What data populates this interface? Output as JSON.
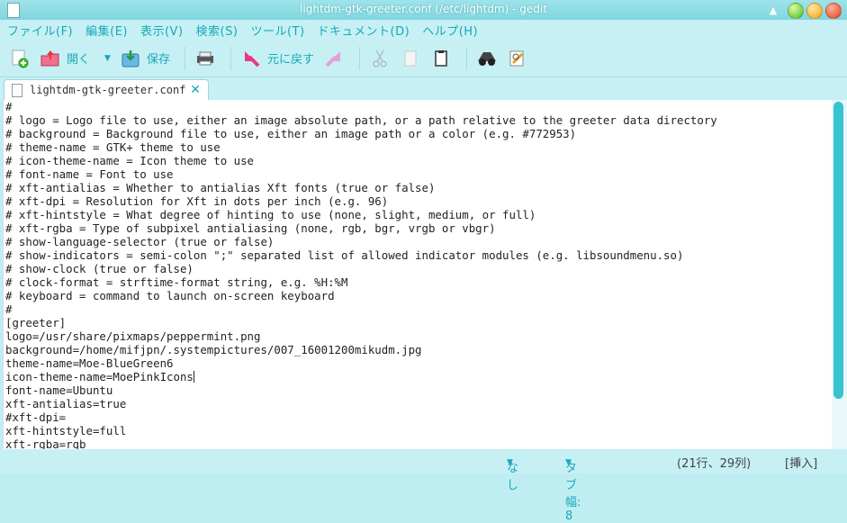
{
  "window": {
    "title": "lightdm-gtk-greeter.conf (/etc/lightdm) - gedit",
    "colors": {
      "accent": "#19a8b8",
      "chrome": "#c6f0f4",
      "titlebar": "#8ad9e1",
      "scroll_thumb": "#37c3cf"
    }
  },
  "menubar": {
    "items": [
      "ファイル(F)",
      "編集(E)",
      "表示(V)",
      "検索(S)",
      "ツール(T)",
      "ドキュメント(D)",
      "ヘルプ(H)"
    ]
  },
  "toolbar": {
    "new_icon": "new-document-icon",
    "open_label": "開く",
    "save_label": "保存",
    "print_icon": "printer-icon",
    "undo_label": "元に戻す",
    "redo_icon": "redo-icon",
    "cut_icon": "scissors-icon",
    "copy_icon": "copy-icon",
    "paste_icon": "paste-icon",
    "find_icon": "binoculars-icon",
    "replace_icon": "find-replace-icon"
  },
  "tab": {
    "label": "lightdm-gtk-greeter.conf"
  },
  "editor": {
    "lines": [
      "#",
      "# logo = Logo file to use, either an image absolute path, or a path relative to the greeter data directory",
      "# background = Background file to use, either an image path or a color (e.g. #772953)",
      "# theme-name = GTK+ theme to use",
      "# icon-theme-name = Icon theme to use",
      "# font-name = Font to use",
      "# xft-antialias = Whether to antialias Xft fonts (true or false)",
      "# xft-dpi = Resolution for Xft in dots per inch (e.g. 96)",
      "# xft-hintstyle = What degree of hinting to use (none, slight, medium, or full)",
      "# xft-rgba = Type of subpixel antialiasing (none, rgb, bgr, vrgb or vbgr)",
      "# show-language-selector (true or false)",
      "# show-indicators = semi-colon \";\" separated list of allowed indicator modules (e.g. libsoundmenu.so)",
      "# show-clock (true or false)",
      "# clock-format = strftime-format string, e.g. %H:%M",
      "# keyboard = command to launch on-screen keyboard",
      "#",
      "[greeter]",
      "logo=/usr/share/pixmaps/peppermint.png",
      "background=/home/mifjpn/.systempictures/007_16001200mikudm.jpg",
      "theme-name=Moe-BlueGreen6",
      "icon-theme-name=MoePinkIcons",
      "font-name=Ubuntu",
      "xft-antialias=true",
      "#xft-dpi=",
      "xft-hintstyle=full",
      "xft-rgba=rgb"
    ],
    "cursor_line": 21,
    "cursor_column": 29
  },
  "statusbar": {
    "language": "なし",
    "tab_width": "タブ幅: 8",
    "position": "(21行、29列)",
    "mode": "[挿入]"
  }
}
